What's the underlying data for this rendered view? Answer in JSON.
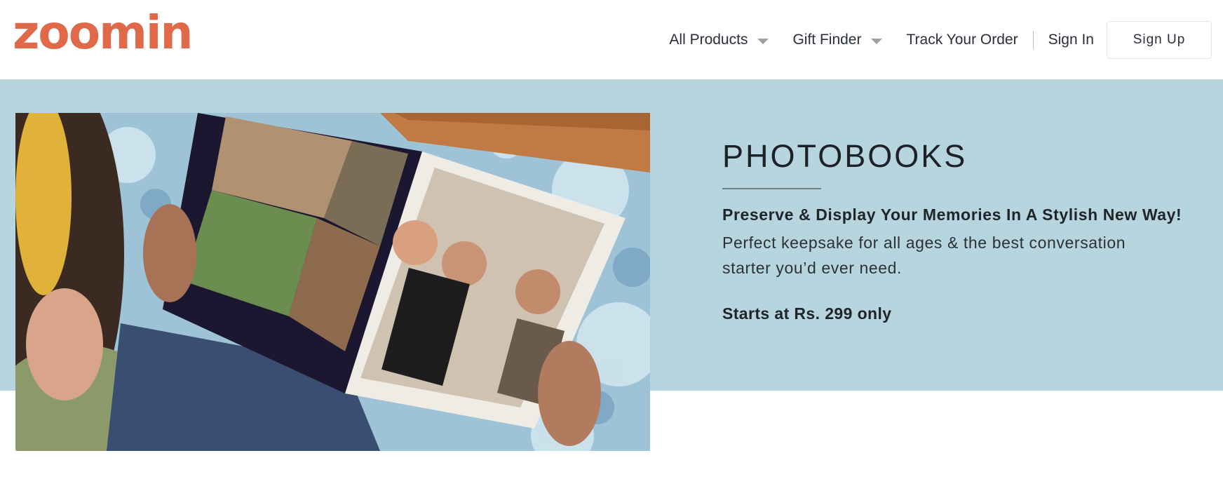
{
  "brand": {
    "logo_text": "zoomin",
    "accent_color": "#e0694a"
  },
  "nav": {
    "all_products": "All Products",
    "gift_finder": "Gift Finder",
    "track_order": "Track Your Order",
    "sign_in": "Sign In",
    "sign_up": "Sign Up"
  },
  "hero": {
    "background_color": "#b7d5de",
    "title": "PHOTOBOOKS",
    "tagline": "Preserve & Display Your Memories In A Stylish New Way!",
    "description": "Perfect keepsake for all ages & the best conversation starter you’d ever need.",
    "price": "Starts at Rs. 299 only",
    "image_icon": "photobook-photo"
  }
}
